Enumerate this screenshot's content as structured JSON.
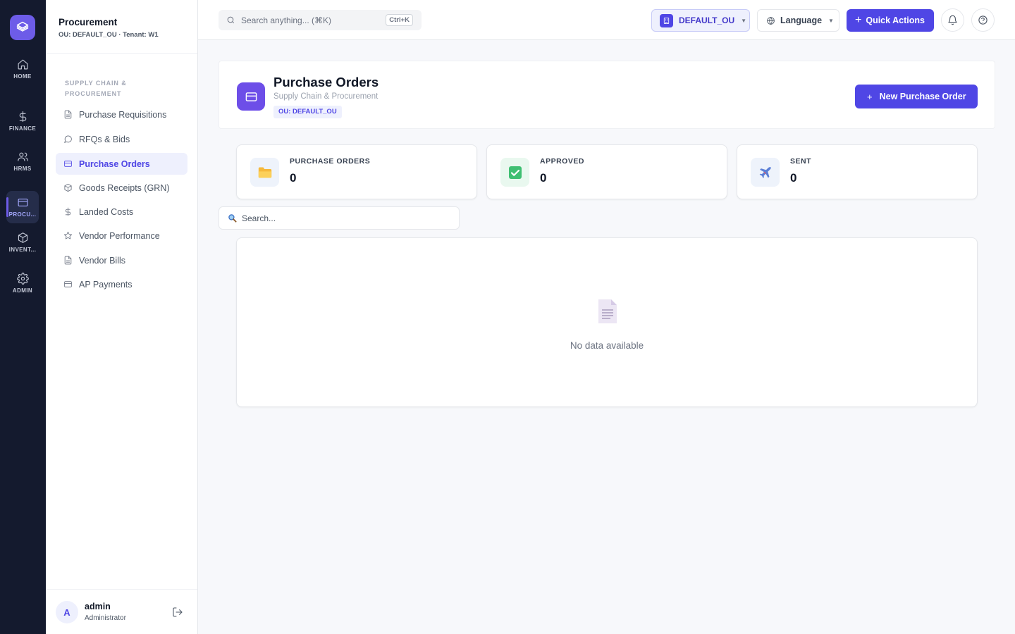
{
  "rail": {
    "items": [
      {
        "label": "HOME",
        "icon": "home-icon"
      },
      {
        "label": "FINANCE",
        "icon": "dollar-icon"
      },
      {
        "label": "HRMS",
        "icon": "users-icon"
      },
      {
        "label": "PROCU...",
        "icon": "card-icon"
      },
      {
        "label": "INVENT...",
        "icon": "box-icon"
      },
      {
        "label": "ADMIN",
        "icon": "gear-icon"
      }
    ],
    "active_index": 3
  },
  "sidebar": {
    "title": "Procurement",
    "subtitle": "OU: DEFAULT_OU · Tenant: W1",
    "section": "SUPPLY CHAIN & PROCUREMENT",
    "items": [
      {
        "label": "Purchase Requisitions",
        "icon": "document-icon"
      },
      {
        "label": "RFQs & Bids",
        "icon": "chat-bubble-icon"
      },
      {
        "label": "Purchase Orders",
        "icon": "card-icon"
      },
      {
        "label": "Goods Receipts (GRN)",
        "icon": "box-icon"
      },
      {
        "label": "Landed Costs",
        "icon": "dollar-icon"
      },
      {
        "label": "Vendor Performance",
        "icon": "star-icon"
      },
      {
        "label": "Vendor Bills",
        "icon": "document-icon"
      },
      {
        "label": "AP Payments",
        "icon": "card-icon"
      }
    ],
    "active_index": 2,
    "user": {
      "initial": "A",
      "name": "admin",
      "role": "Administrator"
    }
  },
  "topbar": {
    "search_placeholder": "Search anything... (⌘K)",
    "shortcut": "Ctrl+K",
    "ou": "DEFAULT_OU",
    "language": "Language",
    "quick_actions": "Quick Actions"
  },
  "page": {
    "title": "Purchase Orders",
    "subtitle": "Supply Chain & Procurement",
    "badge": "OU: DEFAULT_OU",
    "new_button": "New Purchase Order"
  },
  "stats": [
    {
      "label": "PURCHASE ORDERS",
      "value": "0",
      "icon": "folder-icon",
      "bg": "#eef3fb"
    },
    {
      "label": "APPROVED",
      "value": "0",
      "icon": "check-box-icon",
      "bg": "#e9f8ef"
    },
    {
      "label": "SENT",
      "value": "0",
      "icon": "airplane-icon",
      "bg": "#eef3fb"
    }
  ],
  "table": {
    "search_placeholder": "Search...",
    "empty_text": "No data available"
  },
  "colors": {
    "accent": "#4f46e5",
    "rail_bg": "#141a2e",
    "logo": "#6d5ce8"
  }
}
